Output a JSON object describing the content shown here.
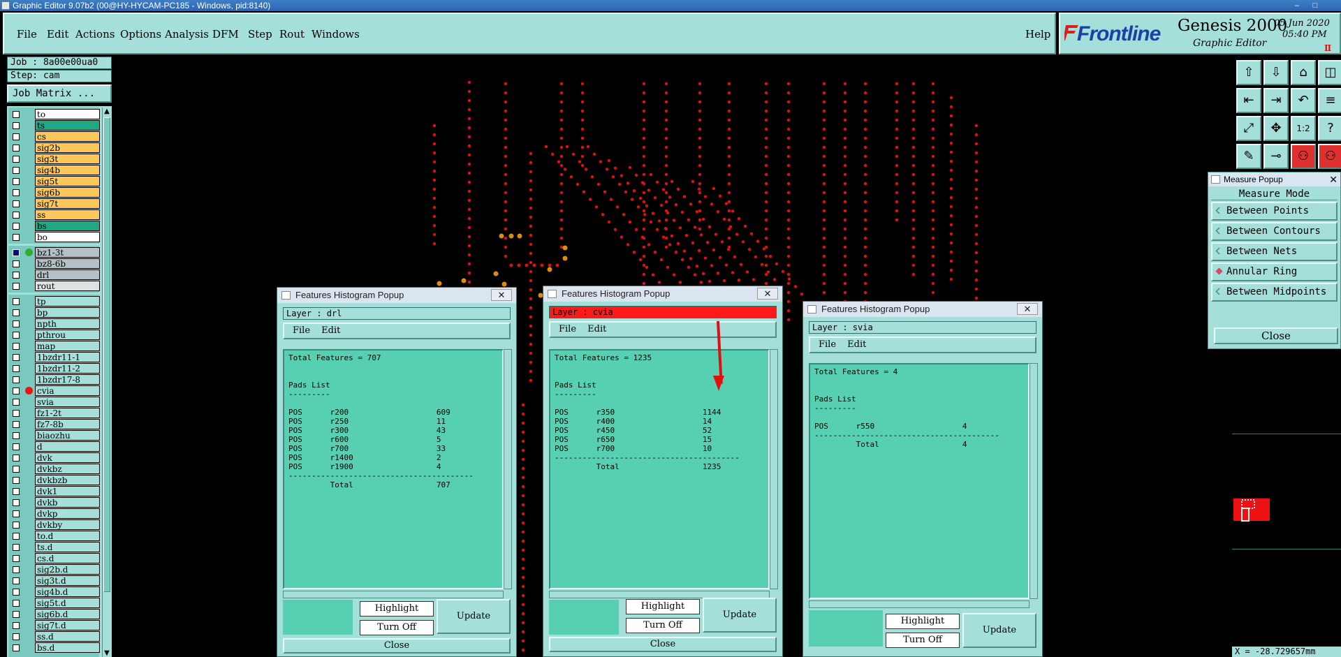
{
  "window": {
    "title": "Graphic Editor 9.07b2 (00@HY-HYCAM-PC185 - Windows, pid:8140)",
    "controls": [
      "–",
      "□"
    ]
  },
  "menu": {
    "items": [
      "File",
      "Edit",
      "Actions",
      "Options",
      "Analysis",
      "DFM",
      "Step",
      "Rout",
      "Windows"
    ],
    "help": "Help"
  },
  "brand": {
    "logo": "Frontline",
    "product": "Genesis 2000",
    "subtitle": "Graphic Editor",
    "date": "05 Jun 2020",
    "time": "05:40 PM",
    "pause_icon": "Ⅱ"
  },
  "job": {
    "job_label": "Job : 8a00e00ua0",
    "step_label": "Step: cam",
    "matrix_button": "Job Matrix ..."
  },
  "layers": {
    "group1": [
      {
        "name": "to",
        "color": "#ffffff"
      },
      {
        "name": "ts",
        "color": "#1fa883"
      },
      {
        "name": "cs",
        "color": "#fcc85a"
      },
      {
        "name": "sig2b",
        "color": "#fcc85a"
      },
      {
        "name": "sig3t",
        "color": "#fcc85a"
      },
      {
        "name": "sig4b",
        "color": "#fcc85a"
      },
      {
        "name": "sig5t",
        "color": "#fcc85a"
      },
      {
        "name": "sig6b",
        "color": "#fcc85a"
      },
      {
        "name": "sig7t",
        "color": "#fcc85a"
      },
      {
        "name": "ss",
        "color": "#fcc85a"
      },
      {
        "name": "bs",
        "color": "#1fa883"
      },
      {
        "name": "bo",
        "color": "#ffffff"
      }
    ],
    "group2": [
      {
        "name": "bz1-3t",
        "color": "#b4c2c8",
        "marker": "#33aa33",
        "selected": true
      },
      {
        "name": "bz8-6b",
        "color": "#b4c2c8"
      },
      {
        "name": "drl",
        "color": "#b4c2c8"
      },
      {
        "name": "rout",
        "color": "#dfe2e2"
      }
    ],
    "group3": [
      {
        "name": "tp"
      },
      {
        "name": "bp"
      },
      {
        "name": "npth"
      },
      {
        "name": "pthrou"
      },
      {
        "name": "map"
      },
      {
        "name": "1bzdr11-1"
      },
      {
        "name": "1bzdr11-2"
      },
      {
        "name": "1bzdr17-8"
      },
      {
        "name": "cvia",
        "marker": "#ee1111"
      },
      {
        "name": "svia"
      },
      {
        "name": "fz1-2t"
      },
      {
        "name": "fz7-8b"
      },
      {
        "name": "biaozhu"
      },
      {
        "name": "d"
      },
      {
        "name": "dvk"
      },
      {
        "name": "dvkbz"
      },
      {
        "name": "dvkbzb"
      },
      {
        "name": "dvk1"
      },
      {
        "name": "dvkb"
      },
      {
        "name": "dvkp"
      },
      {
        "name": "dvkby"
      },
      {
        "name": "to.d"
      },
      {
        "name": "ts.d"
      },
      {
        "name": "cs.d"
      },
      {
        "name": "sig2b.d"
      },
      {
        "name": "sig3t.d"
      },
      {
        "name": "sig4b.d"
      },
      {
        "name": "sig5t.d"
      },
      {
        "name": "sig6b.d"
      },
      {
        "name": "sig7t.d"
      },
      {
        "name": "ss.d"
      },
      {
        "name": "bs.d"
      }
    ],
    "group3_color": "#a5dfd9"
  },
  "toolbar_icons": [
    "open-up-icon",
    "open-down-icon",
    "home-icon",
    "split-view-icon",
    "pan-left-icon",
    "pan-right-icon",
    "zoom-back-icon",
    "layer-stack-icon",
    "zoom-fit-icon",
    "zoom-center-icon",
    "zoom-1to1-icon",
    "help-query-icon",
    "measure-tool-icon",
    "snap-pin-icon",
    "network-icon",
    "network-alt-icon"
  ],
  "measure_popup": {
    "title": "Measure Popup",
    "heading": "Measure Mode",
    "modes": [
      {
        "label": "Between Points",
        "active": false
      },
      {
        "label": "Between Contours",
        "active": false
      },
      {
        "label": "Between Nets",
        "active": false
      },
      {
        "label": "Annular Ring",
        "active": true
      },
      {
        "label": "Between Midpoints",
        "active": false
      }
    ],
    "close": "Close"
  },
  "coord_readout": "X = -28.729657mm",
  "histograms": [
    {
      "title": "Features Histogram Popup",
      "layer": "Layer :  drl",
      "layer_alert": false,
      "menu": [
        "File",
        "Edit"
      ],
      "report": "Total Features = 707\n\n\nPads List\n---------\n\nPOS      r200                   609\nPOS      r250                   11\nPOS      r300                   43\nPOS      r600                   5\nPOS      r700                   33\nPOS      r1400                  2\nPOS      r1900                  4\n----------------------------------------\n         Total                  707",
      "highlight": "Highlight",
      "turn_off": "Turn Off",
      "update": "Update",
      "close": "Close"
    },
    {
      "title": "Features Histogram Popup",
      "layer": "Layer :  cvia",
      "layer_alert": true,
      "menu": [
        "File",
        "Edit"
      ],
      "report": "Total Features = 1235\n\n\nPads List\n---------\n\nPOS      r350                   1144\nPOS      r400                   14\nPOS      r450                   52\nPOS      r650                   15\nPOS      r700                   10\n----------------------------------------\n         Total                  1235",
      "highlight": "Highlight",
      "turn_off": "Turn Off",
      "update": "Update",
      "close": "Close"
    },
    {
      "title": "Features Histogram Popup",
      "layer": "Layer :  svia",
      "layer_alert": false,
      "menu": [
        "File",
        "Edit"
      ],
      "report": "Total Features = 4\n\n\nPads List\n---------\n\nPOS      r550                   4\n----------------------------------------\n         Total                  4",
      "highlight": "Highlight",
      "turn_off": "Turn Off",
      "update": "Update",
      "close": "Close"
    }
  ],
  "colors": {
    "panel": "#a5dfd9",
    "report": "#57cfb1",
    "pad_red": "#e01010",
    "pad_orange": "#e08a10"
  }
}
